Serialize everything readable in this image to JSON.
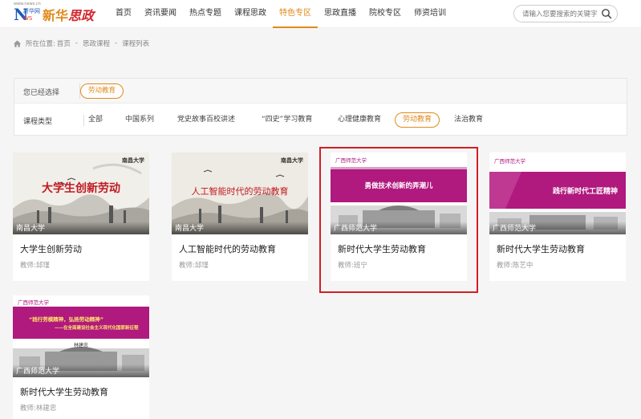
{
  "logo": {
    "mark_letter": "N",
    "mark_small": "新华网",
    "mark_ws": "WS",
    "tiny": "www.news.cn",
    "brand_part1": "新华",
    "brand_part2": "思政"
  },
  "nav": {
    "items": [
      {
        "label": "首页"
      },
      {
        "label": "资讯要闻"
      },
      {
        "label": "热点专题"
      },
      {
        "label": "课程思政"
      },
      {
        "label": "特色专区",
        "active": true
      },
      {
        "label": "思政直播"
      },
      {
        "label": "院校专区"
      },
      {
        "label": "师资培训"
      }
    ]
  },
  "search": {
    "placeholder": "请输入您要搜索的关键字"
  },
  "breadcrumb": {
    "prefix": "所在位置:",
    "items": [
      "首页",
      "思政课程",
      "课程列表"
    ],
    "sep": "-"
  },
  "filter": {
    "selected_label": "您已经选择",
    "selected_tag": "劳动教育",
    "type_label": "课程类型",
    "options": [
      "全部",
      "中国系列",
      "党史故事百校讲述",
      "“四史”学习教育",
      "心理健康教育",
      "劳动教育",
      "法治教育"
    ],
    "active_option": "劳动教育"
  },
  "courses": [
    {
      "title": "大学生创新劳动",
      "teacher_label": "教师:",
      "teacher": "邱瑾",
      "university": "南昌大学",
      "banner": "大学生创新劳动",
      "logo_text": "南昌大学"
    },
    {
      "title": "人工智能时代的劳动教育",
      "teacher_label": "教师:",
      "teacher": "邱瑾",
      "university": "南昌大学",
      "banner": "人工智能时代的劳动教育",
      "logo_text": "南昌大学"
    },
    {
      "title": "新时代大学生劳动教育",
      "teacher_label": "教师:",
      "teacher": "班宁",
      "university": "广西师范大学",
      "banner": "勇做技术创新的弄潮儿",
      "logo_text": "广西师范大学"
    },
    {
      "title": "新时代大学生劳动教育",
      "teacher_label": "教师:",
      "teacher": "陈艺中",
      "university": "广西师范大学",
      "banner": "践行新时代工匠精神",
      "logo_text": "广西师范大学"
    },
    {
      "title": "新时代大学生劳动教育",
      "teacher_label": "教师:",
      "teacher": "林建忠",
      "university": "广西师范大学",
      "banner": "“践行劳模精神，弘扬劳动精神”",
      "banner2": "——在全面建设社会主义现代化国家新征程",
      "speaker": "林建忠",
      "logo_text": "广西师范大学"
    }
  ],
  "colors": {
    "accent": "#e08a1a",
    "highlight": "#d01f27",
    "magenta": "#b0197e",
    "ink_red": "#c0191f"
  }
}
